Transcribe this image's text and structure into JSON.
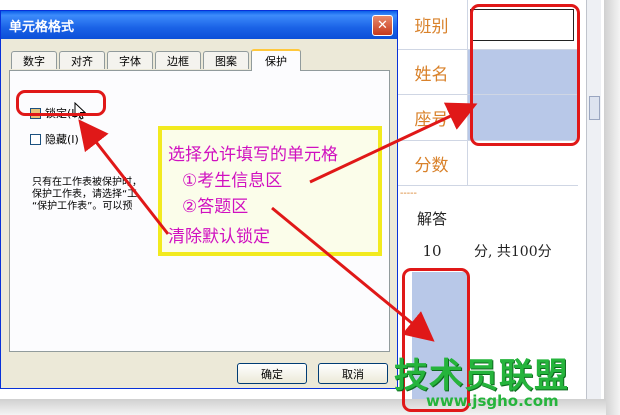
{
  "sheet": {
    "rows": [
      {
        "label": "班别"
      },
      {
        "label": "姓名"
      },
      {
        "label": "座号"
      },
      {
        "label": "分数"
      }
    ],
    "separator": "-----",
    "answer_label": "解答",
    "score_num": "10",
    "score_text": "分, 共100分"
  },
  "dialog": {
    "title": "单元格格式",
    "close_glyph": "✕",
    "tabs": [
      {
        "label": "数字"
      },
      {
        "label": "对齐"
      },
      {
        "label": "字体"
      },
      {
        "label": "边框"
      },
      {
        "label": "图案"
      },
      {
        "label": "保护"
      }
    ],
    "locked_label": "锁定(L)",
    "hidden_label": "隐藏(I)",
    "hint_line1": "只有在工作表被保护时，",
    "hint_line2": "保护工作表，请选择“工",
    "hint_line3": "“保护工作表”。可以预",
    "ok_label": "确定",
    "cancel_label": "取消"
  },
  "annotation": {
    "line1": "选择允许填写的单元格",
    "line2": "①考生信息区",
    "line3": "②答题区",
    "line4": "清除默认锁定"
  },
  "watermark": {
    "logo_text": "技术员联盟",
    "url": "www.jsgho.com"
  },
  "colors": {
    "annotation_text": "#d010c0",
    "annotation_border": "#f2ea1f",
    "highlight_red": "#e01818",
    "unlocked_cell": "#b8c8e8",
    "label_orange": "#d9822b"
  }
}
